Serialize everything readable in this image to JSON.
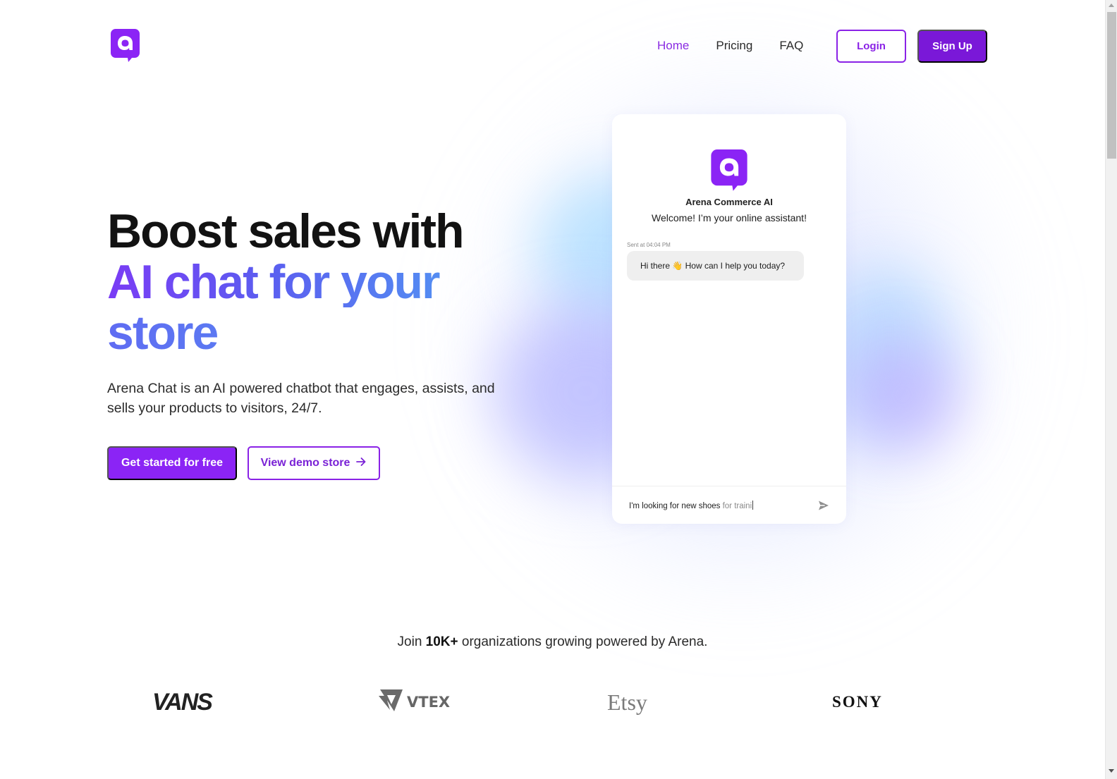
{
  "nav": {
    "logo_alt": "Arena logo",
    "links": [
      {
        "label": "Home",
        "active": true
      },
      {
        "label": "Pricing",
        "active": false
      },
      {
        "label": "FAQ",
        "active": false
      }
    ],
    "login_label": "Login",
    "signup_label": "Sign Up"
  },
  "hero": {
    "title_line1": "Boost sales with",
    "title_line2": "AI chat for your",
    "title_line3": "store",
    "description": "Arena Chat is an AI powered chatbot that engages, assists, and sells your products to visitors, 24/7.",
    "primary_cta": "Get started for free",
    "secondary_cta": "View demo store",
    "secondary_cta_icon": "arrow-right-icon"
  },
  "chat_widget": {
    "bot_name": "Arena Commerce AI",
    "welcome": "Welcome! I’m your online assistant!",
    "sent_at": "Sent at 04:04 PM",
    "message": "Hi there 👋 How can I help you today?",
    "input_typed": "I'm looking for new shoes ",
    "input_typing": "for traini",
    "send_icon": "send-icon"
  },
  "social_proof": {
    "prefix": "Join ",
    "highlight": "10K+",
    "suffix": " organizations growing powered by Arena.",
    "brands": [
      "VANS",
      "VTEX",
      "Etsy",
      "SONY"
    ]
  },
  "colors": {
    "brand_purple": "#8b24f5",
    "signup_purple": "#7a18d8",
    "nav_active": "#8a2be2",
    "gradient_start": "#7a3cf5",
    "gradient_end": "#5595f3"
  }
}
